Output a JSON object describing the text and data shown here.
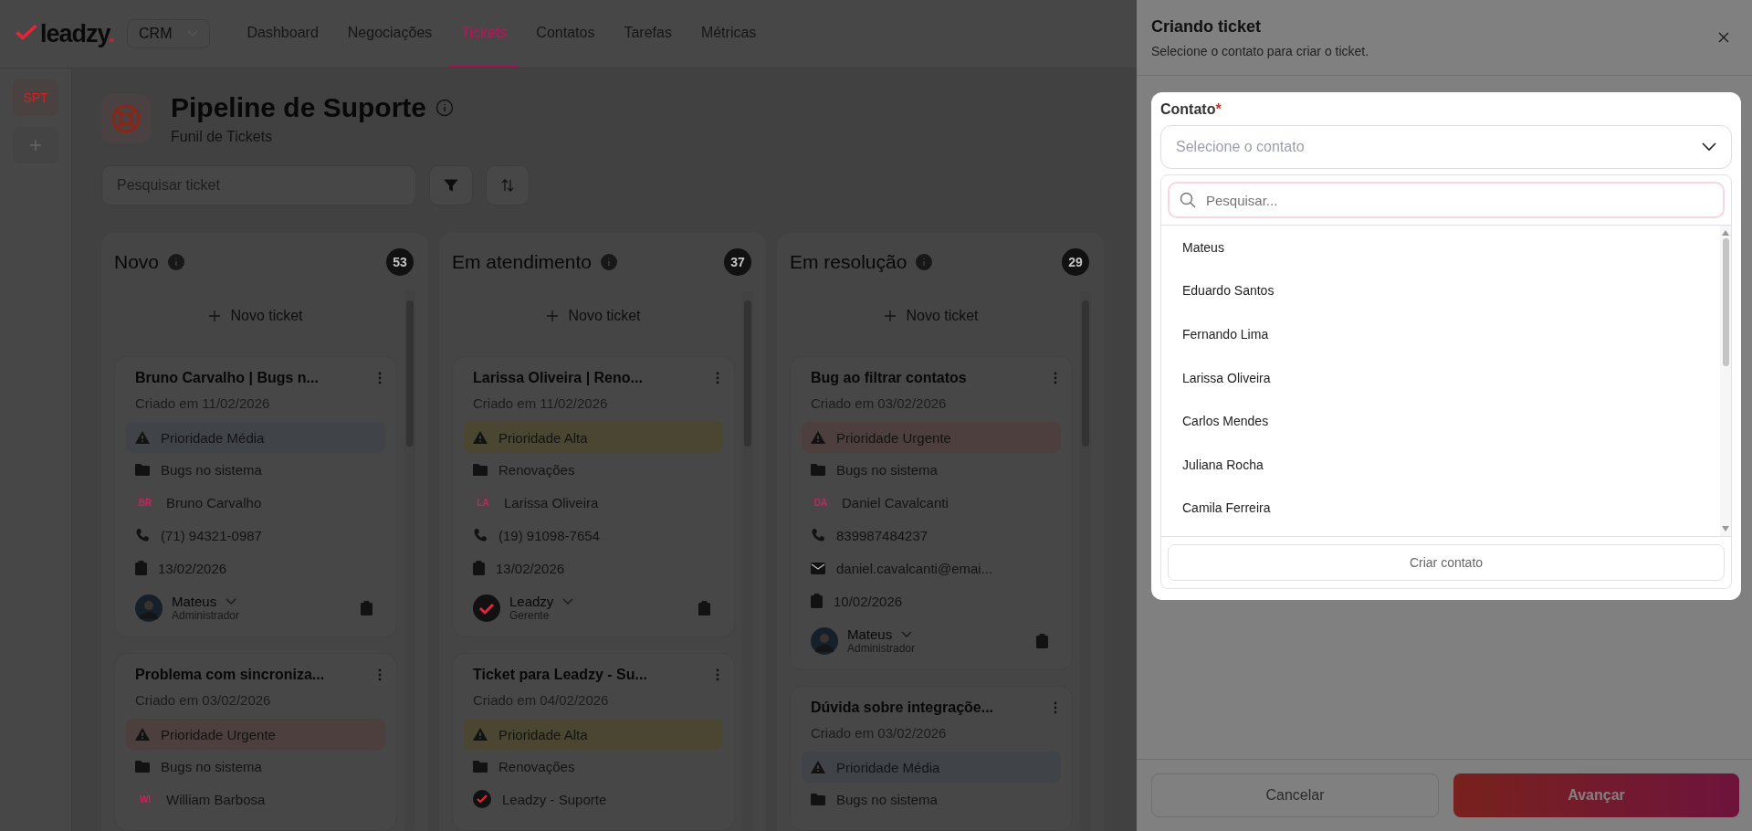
{
  "nav": {
    "logo_text": "leadzy",
    "logo_dot": ".",
    "workspace": "CRM",
    "tabs": [
      {
        "label": "Dashboard",
        "selected": false
      },
      {
        "label": "Negociações",
        "selected": false
      },
      {
        "label": "Tickets",
        "selected": true
      },
      {
        "label": "Contatos",
        "selected": false
      },
      {
        "label": "Tarefas",
        "selected": false
      },
      {
        "label": "Métricas",
        "selected": false
      }
    ]
  },
  "rail": {
    "items": [
      {
        "label": "SPT",
        "selected": true
      }
    ]
  },
  "pipeline": {
    "title": "Pipeline de Suporte",
    "subtitle": "Funil de Tickets",
    "search_placeholder": "Pesquisar ticket"
  },
  "columns": [
    {
      "title": "Novo",
      "count": "53",
      "add_label": "Novo ticket",
      "cards": [
        {
          "title": "Bruno Carvalho | Bugs n...",
          "created": "Criado em 11/02/2026",
          "priority": {
            "label": "Prioridade Média",
            "kind": "medium"
          },
          "rows": [
            {
              "kind": "folder",
              "text": "Bugs no sistema"
            },
            {
              "kind": "contact",
              "initials": "BR",
              "text": "Bruno Carvalho"
            },
            {
              "kind": "phone",
              "text": "(71) 94321-0987"
            },
            {
              "kind": "date",
              "text": "13/02/2026"
            }
          ],
          "owner": {
            "name": "Mateus",
            "role": "Administrador",
            "kind": "photo"
          }
        },
        {
          "title": "Problema com sincroniza...",
          "created": "Criado em 03/02/2026",
          "priority": {
            "label": "Prioridade Urgente",
            "kind": "urgent"
          },
          "rows": [
            {
              "kind": "folder",
              "text": "Bugs no sistema"
            },
            {
              "kind": "contact",
              "initials": "WI",
              "text": "William Barbosa"
            }
          ]
        }
      ]
    },
    {
      "title": "Em atendimento",
      "count": "37",
      "add_label": "Novo ticket",
      "cards": [
        {
          "title": "Larissa Oliveira | Reno...",
          "created": "Criado em 11/02/2026",
          "priority": {
            "label": "Prioridade Alta",
            "kind": "high"
          },
          "rows": [
            {
              "kind": "folder",
              "text": "Renovações"
            },
            {
              "kind": "contact",
              "initials": "LA",
              "text": "Larissa Oliveira"
            },
            {
              "kind": "phone",
              "text": "(19) 91098-7654"
            },
            {
              "kind": "date",
              "text": "13/02/2026"
            }
          ],
          "owner": {
            "name": "Leadzy",
            "role": "Gerente",
            "kind": "logo"
          }
        },
        {
          "title": "Ticket para Leadzy - Su...",
          "created": "Criado em 04/02/2026",
          "priority": {
            "label": "Prioridade Alta",
            "kind": "high"
          },
          "rows": [
            {
              "kind": "folder",
              "text": "Renovações"
            },
            {
              "kind": "contact_logo",
              "text": "Leadzy - Suporte"
            }
          ]
        }
      ]
    },
    {
      "title": "Em resolução",
      "count": "29",
      "add_label": "Novo ticket",
      "cards": [
        {
          "title": "Bug ao filtrar contatos",
          "created": "Criado em 03/02/2026",
          "priority": {
            "label": "Prioridade Urgente",
            "kind": "urgent"
          },
          "rows": [
            {
              "kind": "folder",
              "text": "Bugs no sistema"
            },
            {
              "kind": "contact",
              "initials": "DA",
              "text": "Daniel Cavalcanti"
            },
            {
              "kind": "phone",
              "text": "839987484237"
            },
            {
              "kind": "email",
              "text": "daniel.cavalcanti@emai..."
            },
            {
              "kind": "date",
              "text": "10/02/2026"
            }
          ],
          "owner": {
            "name": "Mateus",
            "role": "Administrador",
            "kind": "photo"
          }
        },
        {
          "title": "Dúvida sobre integraçõe...",
          "created": "Criado em 03/02/2026",
          "priority": {
            "label": "Prioridade Média",
            "kind": "medium"
          },
          "rows": [
            {
              "kind": "folder",
              "text": "Bugs no sistema"
            }
          ]
        }
      ]
    }
  ],
  "drawer": {
    "title": "Criando ticket",
    "subtitle": "Selecione o contato para criar o ticket.",
    "field_label": "Contato",
    "required_mark": "*",
    "select_placeholder": "Selecione o contato",
    "search_placeholder": "Pesquisar...",
    "options": [
      "Mateus",
      "Eduardo Santos",
      "Fernando Lima",
      "Larissa Oliveira",
      "Carlos Mendes",
      "Juliana Rocha",
      "Camila Ferreira"
    ],
    "create_label": "Criar contato",
    "cancel_label": "Cancelar",
    "next_label": "Avançar"
  }
}
